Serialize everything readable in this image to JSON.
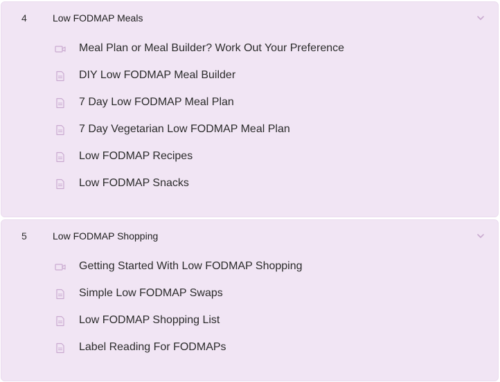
{
  "sections": [
    {
      "number": "4",
      "title": "Low FODMAP Meals",
      "toggle_icon": "chevron-down-icon",
      "items": [
        {
          "type": "video",
          "icon": "video-camera-icon",
          "label": "Meal Plan or Meal Builder? Work Out Your Preference"
        },
        {
          "type": "pdf",
          "icon": "pdf-file-icon",
          "label": "DIY Low FODMAP Meal Builder"
        },
        {
          "type": "pdf",
          "icon": "pdf-file-icon",
          "label": "7 Day Low FODMAP Meal Plan"
        },
        {
          "type": "pdf",
          "icon": "pdf-file-icon",
          "label": "7 Day Vegetarian Low FODMAP Meal Plan"
        },
        {
          "type": "pdf",
          "icon": "pdf-file-icon",
          "label": "Low FODMAP Recipes"
        },
        {
          "type": "pdf",
          "icon": "pdf-file-icon",
          "label": "Low FODMAP Snacks"
        }
      ]
    },
    {
      "number": "5",
      "title": "Low FODMAP Shopping",
      "toggle_icon": "chevron-down-icon",
      "items": [
        {
          "type": "video",
          "icon": "video-camera-icon",
          "label": "Getting Started With Low FODMAP Shopping"
        },
        {
          "type": "pdf",
          "icon": "pdf-file-icon",
          "label": "Simple Low FODMAP Swaps"
        },
        {
          "type": "pdf",
          "icon": "pdf-file-icon",
          "label": "Low FODMAP Shopping List"
        },
        {
          "type": "pdf",
          "icon": "pdf-file-icon",
          "label": "Label Reading For FODMAPs"
        }
      ]
    }
  ],
  "colors": {
    "section_bg": "#f1e5f4",
    "icon": "#c9a9cf",
    "text": "#2b2b2b"
  }
}
